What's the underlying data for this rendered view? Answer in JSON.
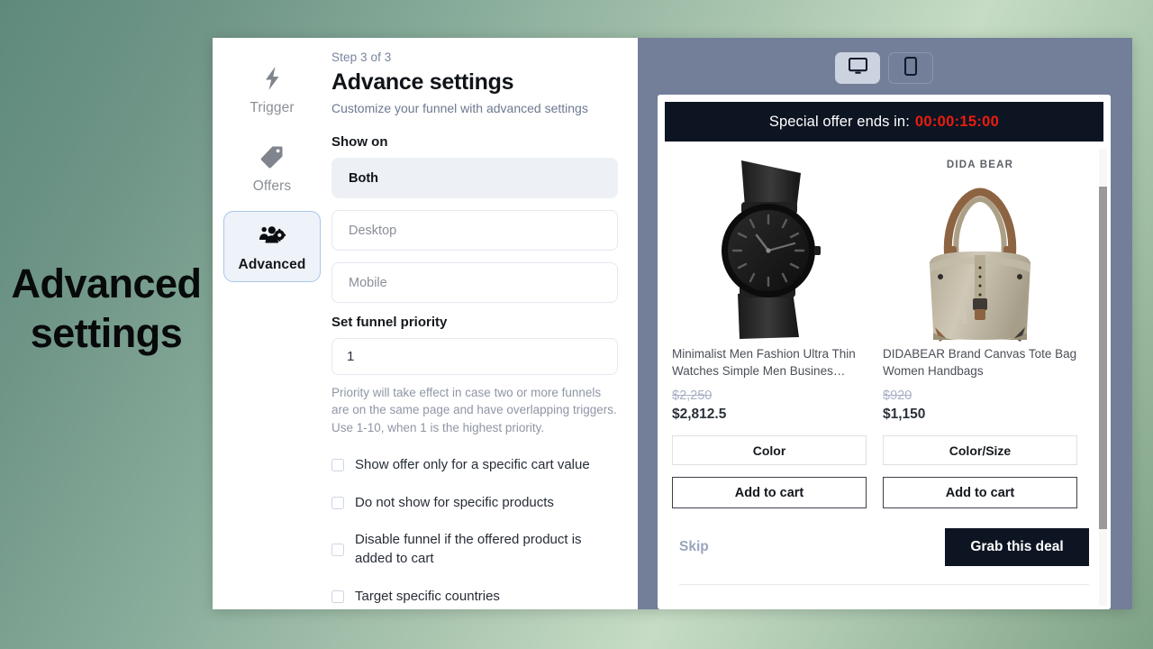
{
  "caption": {
    "line1": "Advanced",
    "line2": "settings"
  },
  "steps": [
    {
      "label": "Trigger",
      "icon": "lightning-bolt-icon",
      "active": false
    },
    {
      "label": "Offers",
      "icon": "tag-icon",
      "active": false
    },
    {
      "label": "Advanced",
      "icon": "people-gear-icon",
      "active": true
    }
  ],
  "form": {
    "step_count": "Step 3 of 3",
    "title": "Advance settings",
    "subtitle": "Customize your funnel with advanced settings",
    "show_on_label": "Show on",
    "show_on_options": [
      "Both",
      "Desktop",
      "Mobile"
    ],
    "show_on_selected": "Both",
    "priority_label": "Set funnel priority",
    "priority_value": "1",
    "priority_helper": "Priority will take effect in case two or more funnels are on the same page and have overlapping triggers. Use 1-10, when 1 is the highest priority.",
    "checkboxes": [
      {
        "label": "Show offer only for a specific cart value",
        "checked": false
      },
      {
        "label": "Do not show for specific products",
        "checked": false
      },
      {
        "label": "Disable funnel if the offered product is added to cart",
        "checked": false
      },
      {
        "label": "Target specific countries",
        "checked": false
      }
    ]
  },
  "preview": {
    "devices": [
      {
        "name": "desktop",
        "icon": "monitor-icon",
        "active": true
      },
      {
        "name": "mobile",
        "icon": "phone-icon",
        "active": false
      }
    ],
    "timer": {
      "label": "Special offer ends in:",
      "value": "00:00:15:00",
      "value_color": "#ec1c0f"
    },
    "products": [
      {
        "brand": "",
        "title": "Minimalist Men Fashion Ultra Thin Watches Simple Men Busines…",
        "old_price": "$2,250",
        "new_price": "$2,812.5",
        "variant_label": "Color",
        "add_to_cart_label": "Add to cart",
        "image": "black-mesh-watch"
      },
      {
        "brand": "DIDA BEAR",
        "title": "DIDABEAR Brand Canvas Tote Bag Women Handbags",
        "old_price": "$920",
        "new_price": "$1,150",
        "variant_label": "Color/Size",
        "add_to_cart_label": "Add to cart",
        "image": "canvas-tote-bag"
      }
    ],
    "skip_label": "Skip",
    "grab_label": "Grab this deal"
  },
  "colors": {
    "preview_panel": "#737f99",
    "timer_bar": "#0d1523",
    "timer_value": "#ec1c0f",
    "accent_selected": "#edf0f5",
    "active_step_border": "#a9c8ec"
  }
}
